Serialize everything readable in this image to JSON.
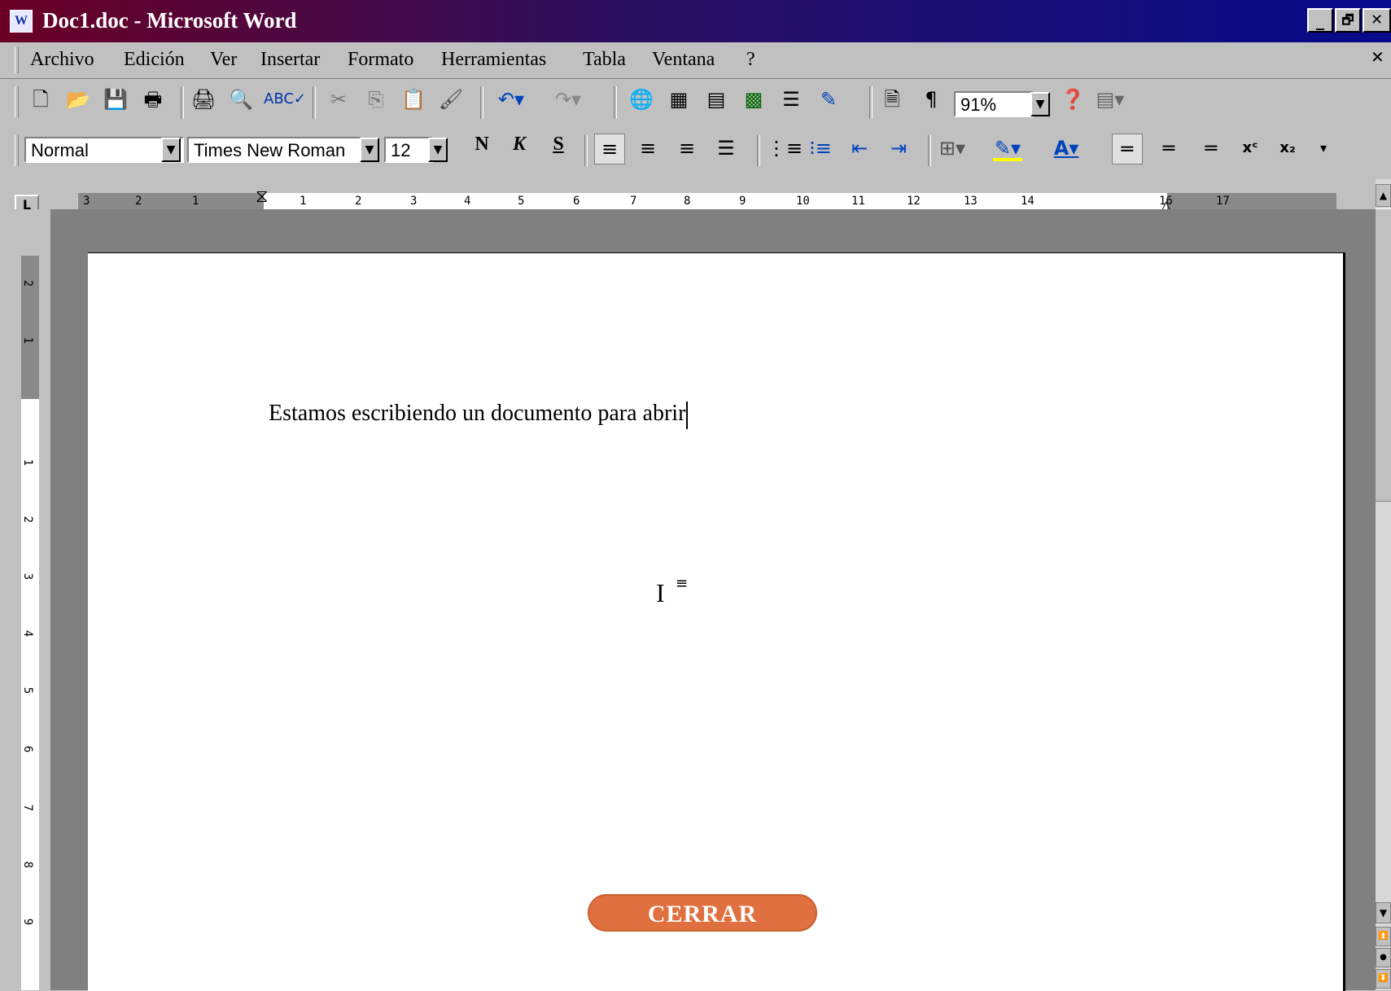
{
  "window": {
    "title": "Doc1.doc - Microsoft Word",
    "app_icon": "word-doc-icon",
    "controls": {
      "minimize": "_",
      "restore": "🗗",
      "close": "✕"
    }
  },
  "menubar": {
    "items": [
      "Archivo",
      "Edición",
      "Ver",
      "Insertar",
      "Formato",
      "Herramientas",
      "Tabla",
      "Ventana",
      "?"
    ],
    "close_doc": "✕"
  },
  "standard_toolbar": {
    "zoom": "91%",
    "icons": [
      "new-icon",
      "open-icon",
      "save-icon",
      "print-preview-web-icon",
      "print-icon",
      "print-preview-icon",
      "spelling-icon",
      "cut-icon",
      "copy-icon",
      "paste-icon",
      "format-painter-icon",
      "undo-icon",
      "redo-icon",
      "hyperlink-icon",
      "tables-borders-icon",
      "insert-table-icon",
      "insert-excel-icon",
      "columns-icon",
      "drawing-icon",
      "document-map-icon",
      "show-formatting-icon",
      "help-icon",
      "more-buttons-icon"
    ]
  },
  "formatting_toolbar": {
    "style": "Normal",
    "font": "Times New Roman",
    "size": "12",
    "bold": "N",
    "italic": "K",
    "underline": "S"
  },
  "ruler": {
    "labels": [
      "3",
      "2",
      "1",
      "1",
      "2",
      "3",
      "4",
      "5",
      "6",
      "7",
      "8",
      "9",
      "10",
      "11",
      "12",
      "13",
      "14",
      "16",
      "17"
    ]
  },
  "vertical_ruler": {
    "labels": [
      "2",
      "1",
      "1",
      "2",
      "3",
      "4",
      "5",
      "6",
      "7",
      "8",
      "9"
    ]
  },
  "document": {
    "text": "Estamos escribiendo un documento para abrir"
  },
  "overlay": {
    "close_button": "CERRAR"
  }
}
